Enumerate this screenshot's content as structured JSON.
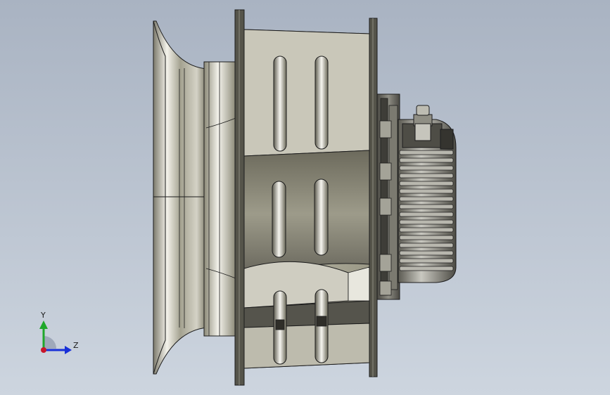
{
  "viewport": {
    "background_top": "#a9b3c2",
    "background_bottom": "#ccd4de",
    "model": "centrifugal-fan-assembly",
    "view_orientation": "side-view",
    "edge_color": "#1c1c1c",
    "metal_dark": "#6f6d60",
    "metal_mid": "#a9a796",
    "metal_light": "#ecebe2"
  },
  "triad": {
    "y_label": "Y",
    "z_label": "Z",
    "colors": {
      "y": "#1fa82a",
      "z": "#1830d8",
      "x": "#d81a1a",
      "origin": "#c8162a"
    }
  }
}
